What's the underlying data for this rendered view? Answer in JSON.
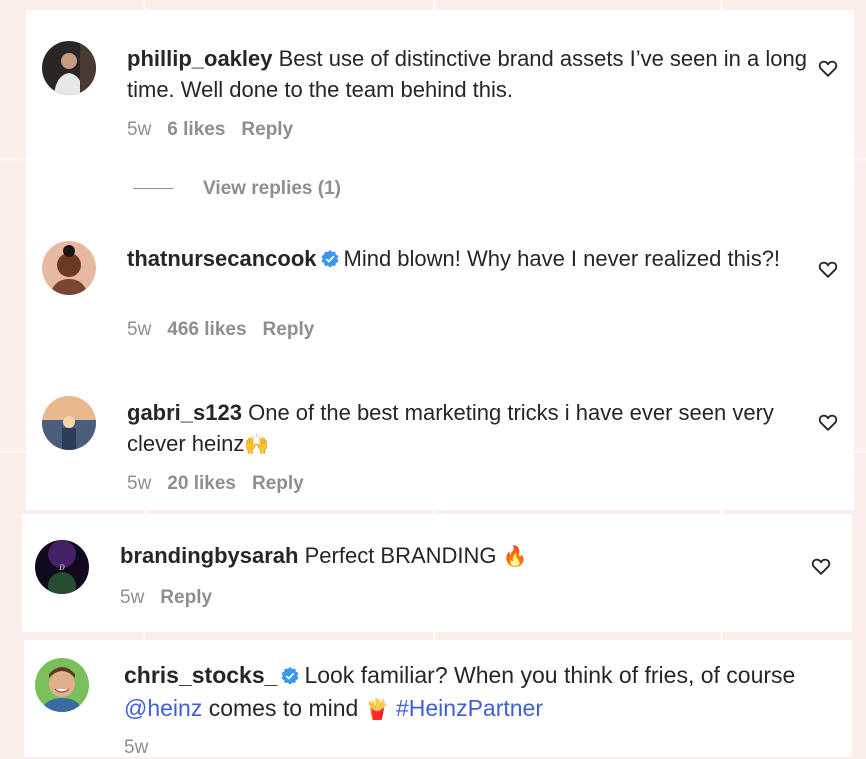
{
  "comments": [
    {
      "username": "phillip_oakley",
      "text": "Best use of distinctive brand assets I’ve seen in a long time. Well done to the team behind this.",
      "time": "5w",
      "likes": "6 likes",
      "reply": "Reply",
      "view_replies": "View replies (1)"
    },
    {
      "username": "thatnursecancook",
      "text": "Mind blown! Why have I never realized this?!",
      "time": "5w",
      "likes": "466 likes",
      "reply": "Reply"
    },
    {
      "username": "gabri_s123",
      "text": "One of the best marketing tricks i have ever seen very clever heinz",
      "emoji": "🙌",
      "time": "5w",
      "likes": "20 likes",
      "reply": "Reply"
    },
    {
      "username": "brandingbysarah",
      "text": "Perfect BRANDING",
      "emoji": "🔥",
      "time": "5w",
      "reply": "Reply"
    },
    {
      "username": "chris_stocks_",
      "text_a": "Look familiar? When you think of fries, of course",
      "mention": "@heinz",
      "text_b": "comes to mind",
      "emoji": "🍟",
      "hashtag": "#HeinzPartner",
      "time": "5w"
    }
  ],
  "colors": {
    "background": "#fbeeea",
    "card": "#ffffff",
    "text": "#262626",
    "muted": "#8e8e8e",
    "link": "#3f5fd9",
    "verified": "#3897f0"
  },
  "icons": {
    "like": "heart-outline-icon",
    "verified": "verified-badge-icon"
  }
}
